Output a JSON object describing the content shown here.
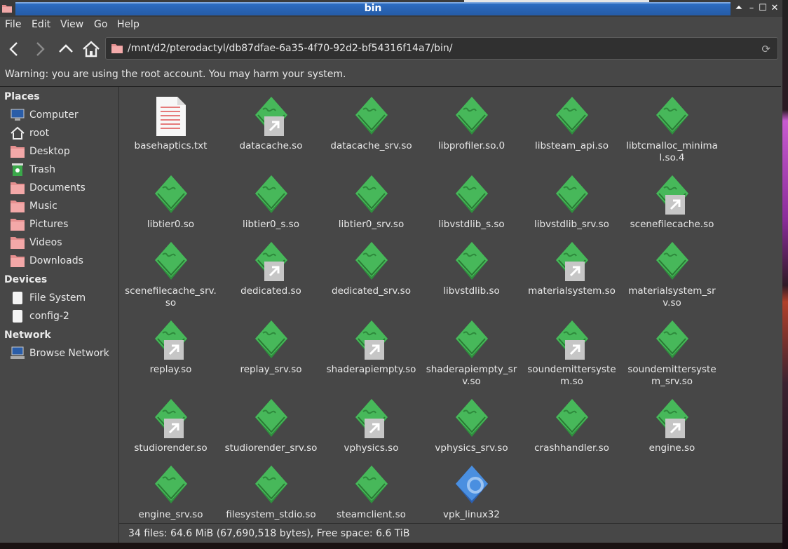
{
  "window": {
    "title": "bin"
  },
  "menu": [
    "File",
    "Edit",
    "View",
    "Go",
    "Help"
  ],
  "path": "/mnt/d2/pterodactyl/db87dfae-6a35-4f70-92d2-bf54316f14a7/bin/",
  "warning": "Warning: you are using the root account. You may harm your system.",
  "sidebar": {
    "places_title": "Places",
    "places": [
      "Computer",
      "root",
      "Desktop",
      "Trash",
      "Documents",
      "Music",
      "Pictures",
      "Videos",
      "Downloads"
    ],
    "devices_title": "Devices",
    "devices": [
      "File System",
      "config-2"
    ],
    "network_title": "Network",
    "network": [
      "Browse Network"
    ]
  },
  "files": [
    {
      "name": "basehaptics.txt",
      "kind": "text",
      "link": false
    },
    {
      "name": "datacache.so",
      "kind": "lib",
      "link": true
    },
    {
      "name": "datacache_srv.so",
      "kind": "lib",
      "link": false
    },
    {
      "name": "libprofiler.so.0",
      "kind": "lib",
      "link": false
    },
    {
      "name": "libsteam_api.so",
      "kind": "lib",
      "link": false
    },
    {
      "name": "libtcmalloc_minimal.so.4",
      "kind": "lib",
      "link": false
    },
    {
      "name": "libtier0.so",
      "kind": "lib",
      "link": false
    },
    {
      "name": "libtier0_s.so",
      "kind": "lib",
      "link": false
    },
    {
      "name": "libtier0_srv.so",
      "kind": "lib",
      "link": false
    },
    {
      "name": "libvstdlib_s.so",
      "kind": "lib",
      "link": false
    },
    {
      "name": "libvstdlib_srv.so",
      "kind": "lib",
      "link": false
    },
    {
      "name": "scenefilecache.so",
      "kind": "lib",
      "link": true
    },
    {
      "name": "scenefilecache_srv.so",
      "kind": "lib",
      "link": false
    },
    {
      "name": "dedicated.so",
      "kind": "lib",
      "link": true
    },
    {
      "name": "dedicated_srv.so",
      "kind": "lib",
      "link": false
    },
    {
      "name": "libvstdlib.so",
      "kind": "lib",
      "link": false
    },
    {
      "name": "materialsystem.so",
      "kind": "lib",
      "link": true
    },
    {
      "name": "materialsystem_srv.so",
      "kind": "lib",
      "link": false
    },
    {
      "name": "replay.so",
      "kind": "lib",
      "link": true
    },
    {
      "name": "replay_srv.so",
      "kind": "lib",
      "link": false
    },
    {
      "name": "shaderapiempty.so",
      "kind": "lib",
      "link": true
    },
    {
      "name": "shaderapiempty_srv.so",
      "kind": "lib",
      "link": false
    },
    {
      "name": "soundemittersystem.so",
      "kind": "lib",
      "link": true
    },
    {
      "name": "soundemittersystem_srv.so",
      "kind": "lib",
      "link": false
    },
    {
      "name": "studiorender.so",
      "kind": "lib",
      "link": true
    },
    {
      "name": "studiorender_srv.so",
      "kind": "lib",
      "link": false
    },
    {
      "name": "vphysics.so",
      "kind": "lib",
      "link": true
    },
    {
      "name": "vphysics_srv.so",
      "kind": "lib",
      "link": false
    },
    {
      "name": "crashhandler.so",
      "kind": "lib",
      "link": false
    },
    {
      "name": "engine.so",
      "kind": "lib",
      "link": true
    },
    {
      "name": "engine_srv.so",
      "kind": "lib",
      "link": false
    },
    {
      "name": "filesystem_stdio.so",
      "kind": "lib",
      "link": false
    },
    {
      "name": "steamclient.so",
      "kind": "lib",
      "link": false
    },
    {
      "name": "vpk_linux32",
      "kind": "exec",
      "link": false
    }
  ],
  "status": "34 files: 64.6 MiB (67,690,518 bytes), Free space: 6.6 TiB",
  "colors": {
    "lib_green": "#3aa84a",
    "exec_blue": "#3f7fd8",
    "titlebar": "#2a66b8"
  }
}
